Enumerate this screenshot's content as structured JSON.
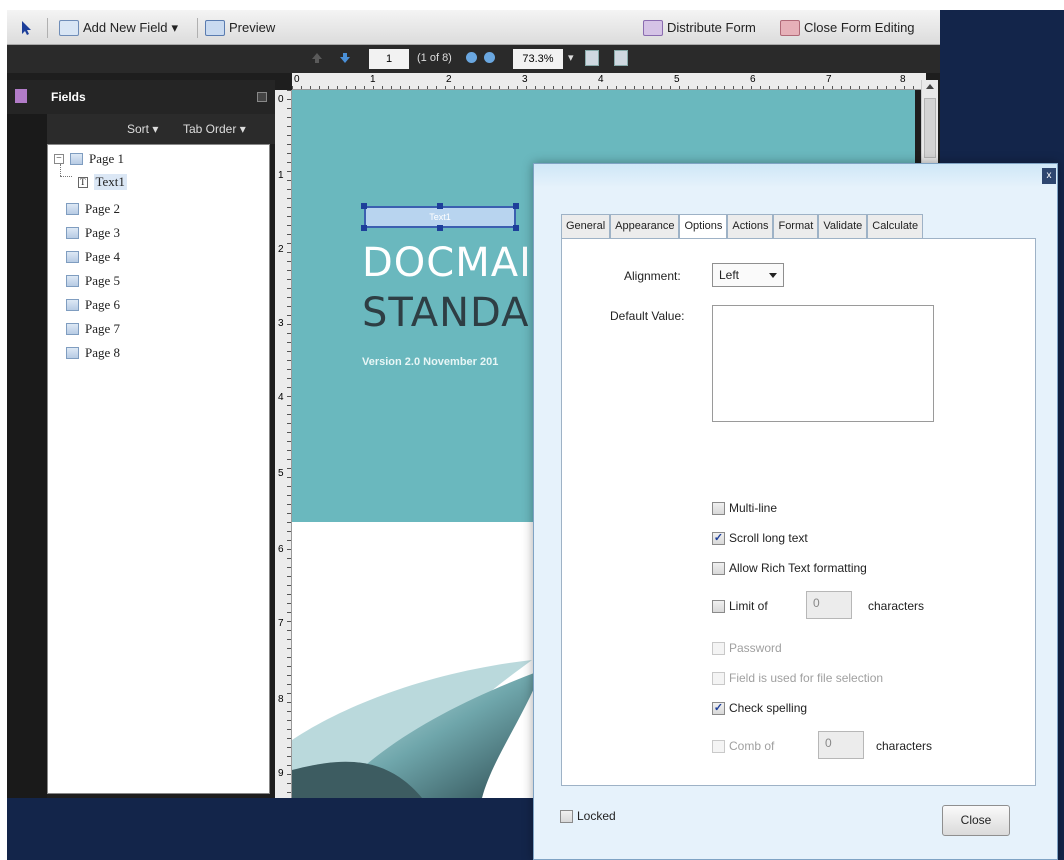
{
  "toolbar": {
    "add_field": "Add New Field",
    "preview": "Preview",
    "distribute": "Distribute Form",
    "close_editing": "Close Form Editing",
    "dropdown_caret": "▾"
  },
  "navbar": {
    "page_number": "1",
    "page_count": "(1 of 8)",
    "zoom": "73.3%"
  },
  "fields_panel": {
    "title": "Fields",
    "sort": "Sort",
    "tab_order": "Tab Order",
    "tree": [
      {
        "label": "Page 1"
      },
      {
        "label": "Text1"
      },
      {
        "label": "Page 2"
      },
      {
        "label": "Page 3"
      },
      {
        "label": "Page 4"
      },
      {
        "label": "Page 5"
      },
      {
        "label": "Page 6"
      },
      {
        "label": "Page 7"
      },
      {
        "label": "Page 8"
      }
    ]
  },
  "ruler": {
    "h_numbers": [
      "0",
      "1",
      "2",
      "3",
      "4",
      "5",
      "6",
      "7",
      "8"
    ],
    "v_numbers": [
      "0",
      "1",
      "2",
      "3",
      "4",
      "5",
      "6",
      "7",
      "8",
      "9"
    ]
  },
  "document": {
    "field_label": "Text1",
    "title_line1": "DOCMAI",
    "title_line2": "STANDAI",
    "version": "Version 2.0 November 201",
    "colors": {
      "teal": "#6ab8be",
      "title1": "#ffffff",
      "title2": "#2e3e44"
    }
  },
  "dialog": {
    "close_glyph": "x",
    "tabs": [
      "General",
      "Appearance",
      "Options",
      "Actions",
      "Format",
      "Validate",
      "Calculate"
    ],
    "active_tab": "Options",
    "alignment_label": "Alignment:",
    "alignment_value": "Left",
    "default_value_label": "Default Value:",
    "options": {
      "multiline": {
        "label": "Multi-line",
        "checked": false
      },
      "scroll": {
        "label": "Scroll long text",
        "checked": true
      },
      "rich": {
        "label": "Allow Rich Text formatting",
        "checked": false
      },
      "limit": {
        "label": "Limit of",
        "value": "0",
        "suffix": "characters"
      },
      "password": {
        "label": "Password",
        "checked": false
      },
      "file_select": {
        "label": "Field is used for file selection",
        "checked": false
      },
      "spelling": {
        "label": "Check spelling",
        "checked": true
      },
      "comb": {
        "label": "Comb of",
        "value": "0",
        "suffix": "characters"
      }
    },
    "locked_label": "Locked",
    "close_button": "Close"
  }
}
